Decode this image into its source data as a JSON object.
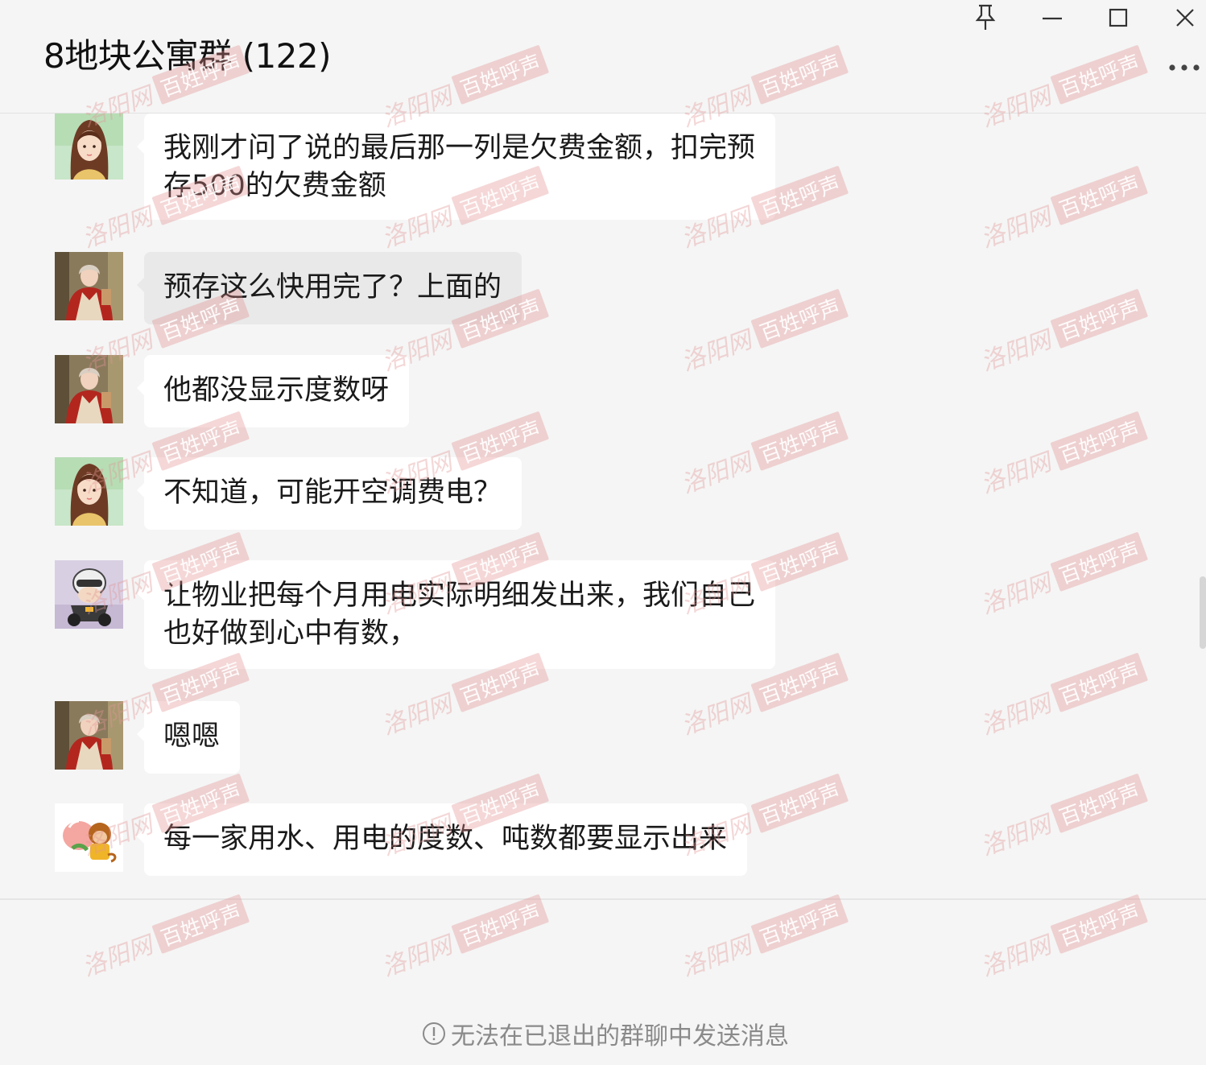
{
  "window": {
    "title": "8地块公寓群 (122)",
    "controls": {
      "pin_icon": "pin-icon",
      "minimize_icon": "minimize-icon",
      "maximize_icon": "maximize-icon",
      "close_icon": "close-icon",
      "more_icon": "more-icon"
    }
  },
  "messages": [
    {
      "avatar": "girl-illustration-avatar",
      "lines": [
        "我刚才问了说的最后那一列是欠费金额，扣完预",
        "存500的欠费金额"
      ]
    },
    {
      "avatar": "woman-red-dress-avatar",
      "lines": [
        "预存这么快用完了？上面的"
      ]
    },
    {
      "avatar": "woman-red-dress-avatar",
      "lines": [
        "他都没显示度数呀"
      ]
    },
    {
      "avatar": "girl-illustration-avatar",
      "lines": [
        "不知道，可能开空调费电？"
      ]
    },
    {
      "avatar": "cartoon-motorcycle-avatar",
      "lines": [
        "让物业把每个月用电实际明细发出来，我们自己",
        "也好做到心中有数，"
      ]
    },
    {
      "avatar": "woman-red-dress-avatar",
      "lines": [
        "嗯嗯"
      ]
    },
    {
      "avatar": "monkey-peach-avatar",
      "lines": [
        "每一家用水、用电的度数、吨数都要显示出来"
      ]
    }
  ],
  "footer": {
    "notice_icon": "info-circle-icon",
    "notice": "无法在已退出的群聊中发送消息"
  },
  "watermark": {
    "part_a": "洛阳网",
    "part_b": "百姓呼声"
  }
}
